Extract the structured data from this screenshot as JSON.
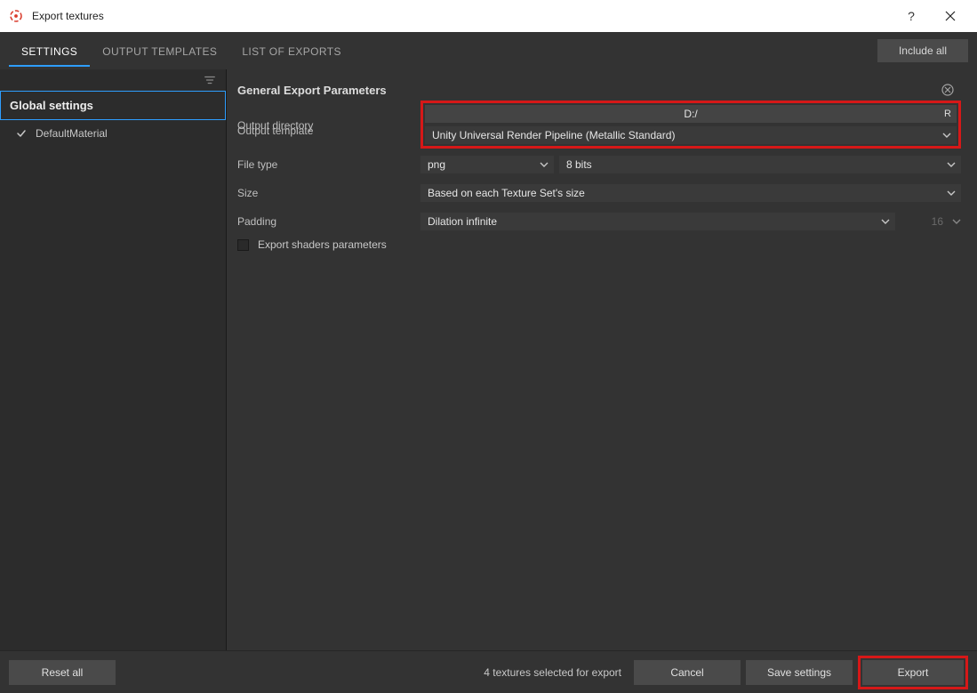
{
  "titlebar": {
    "title": "Export textures",
    "help_label": "?",
    "close_label": "✕"
  },
  "topbar": {
    "tabs": {
      "settings": "SETTINGS",
      "templates": "OUTPUT TEMPLATES",
      "exports_list": "LIST OF EXPORTS"
    },
    "include_all_label": "Include all"
  },
  "sidebar": {
    "global_settings_label": "Global settings",
    "material_name": "DefaultMaterial"
  },
  "content": {
    "header_title": "General Export Parameters",
    "labels": {
      "output_dir": "Output directory",
      "output_template": "Output template",
      "file_type": "File type",
      "size": "Size",
      "padding": "Padding",
      "export_shaders": "Export shaders parameters"
    },
    "values": {
      "output_dir": "D:/",
      "output_dir_suffix": "R",
      "output_template": "Unity Universal Render Pipeline (Metallic Standard)",
      "file_type": "png",
      "bit_depth": "8 bits",
      "size": "Based on each Texture Set's size",
      "padding": "Dilation infinite",
      "padding_val": "16"
    }
  },
  "footer": {
    "reset_label": "Reset all",
    "status": "4 textures selected for export",
    "cancel_label": "Cancel",
    "save_label": "Save settings",
    "export_label": "Export"
  }
}
